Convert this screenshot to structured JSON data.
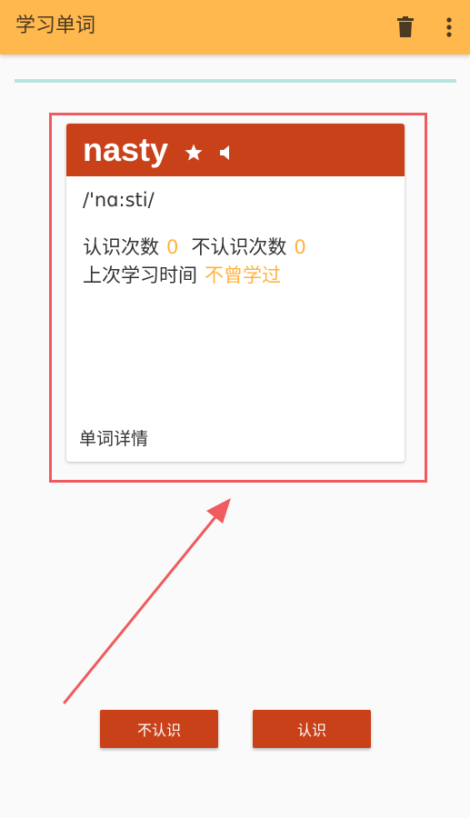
{
  "toolbar": {
    "title": "学习单词",
    "trash_icon": "trash-icon",
    "more_icon": "more-vert-icon",
    "background_color": "#ffb84d"
  },
  "progress": {
    "value_fraction": 0.0,
    "track_color": "#b9e3df"
  },
  "card": {
    "word": "nasty",
    "phonetic": "/'nɑ:sti/",
    "star_icon": "star-icon",
    "speaker_icon": "speaker-icon",
    "header_color": "#c94119",
    "known_count_label": "认识次数",
    "known_count_value": "0",
    "unknown_count_label": "不认识次数",
    "unknown_count_value": "0",
    "last_study_label": "上次学习时间",
    "last_study_value": "不曾学过",
    "details_link": "单词详情",
    "value_color": "#ffb23e"
  },
  "annotation": {
    "highlight_color": "#ef5b5e",
    "arrow_icon": "arrow-annotation-icon"
  },
  "actions": {
    "unknown_button": "不认识",
    "known_button": "认识",
    "button_color": "#c94119"
  }
}
